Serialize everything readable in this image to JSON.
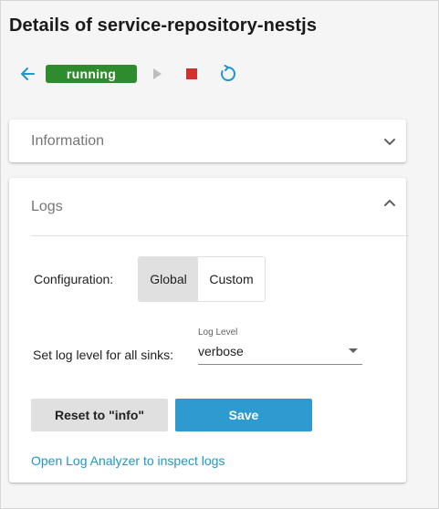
{
  "page": {
    "title": "Details of service-repository-nestjs"
  },
  "toolbar": {
    "back_icon": "arrow-left-icon",
    "status": "running",
    "play_icon": "play-icon",
    "stop_icon": "stop-icon",
    "restart_icon": "restart-icon"
  },
  "information_panel": {
    "title": "Information",
    "expanded": false
  },
  "logs_panel": {
    "title": "Logs",
    "expanded": true,
    "configuration_label": "Configuration:",
    "configuration_options": [
      "Global",
      "Custom"
    ],
    "configuration_selected": "Global",
    "sinks_label": "Set log level for all sinks:",
    "log_level_label": "Log Level",
    "log_level_value": "verbose",
    "reset_button": "Reset to \"info\"",
    "save_button": "Save",
    "analyzer_link": "Open Log Analyzer to inspect logs"
  },
  "colors": {
    "accent": "#2196c9",
    "status_running": "#2e8b2e",
    "stop": "#d32f2f",
    "play_disabled": "#bdbdbd",
    "save_button": "#2d9bd0"
  }
}
